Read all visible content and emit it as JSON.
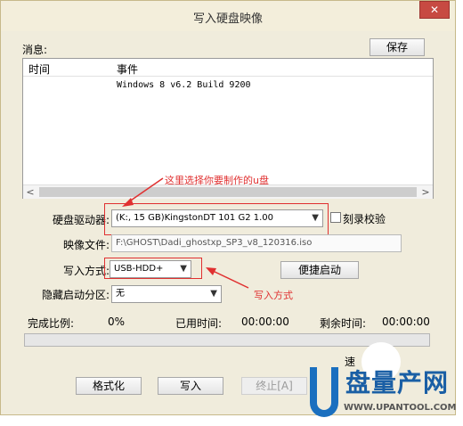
{
  "window": {
    "title": "写入硬盘映像",
    "close_glyph": "✕"
  },
  "messages": {
    "label": "消息:",
    "save_button": "保存",
    "columns": [
      "时间",
      "事件"
    ],
    "rows": [
      {
        "time": "",
        "event": "Windows 8 v6.2 Build 9200"
      }
    ],
    "scroll_left": "<",
    "scroll_right": ">"
  },
  "drive": {
    "label": "硬盘驱动器:",
    "value": "(K:, 15 GB)KingstonDT 101 G2       1.00",
    "verify_label": "刻录校验",
    "verify_checked": false
  },
  "image_file": {
    "label": "映像文件:",
    "value": "F:\\GHOST\\Dadi_ghostxp_SP3_v8_120316.iso"
  },
  "write_mode": {
    "label": "写入方式:",
    "value": "USB-HDD+",
    "quick_boot_button": "便捷启动"
  },
  "hidden_partition": {
    "label": "隐藏启动分区:",
    "value": "无"
  },
  "progress": {
    "complete_label": "完成比例:",
    "complete_value": "0%",
    "elapsed_label": "已用时间:",
    "elapsed_value": "00:00:00",
    "remaining_label": "剩余时间:",
    "remaining_value": "00:00:00",
    "fraction": 0,
    "speed_label": "速"
  },
  "buttons": {
    "format": "格式化",
    "write": "写入",
    "abort": "终止[A]"
  },
  "annotations": {
    "drive_note": "这里选择你要制作的u盘",
    "mode_note": "写入方式",
    "color": "#e03030"
  },
  "watermark": {
    "brand": "盘量产网",
    "url": "WWW.UPANTOOL.COM"
  },
  "colors": {
    "window_bg": "#f0ecdc",
    "close_bg": "#c74a42",
    "accent": "#1a6fbf"
  }
}
